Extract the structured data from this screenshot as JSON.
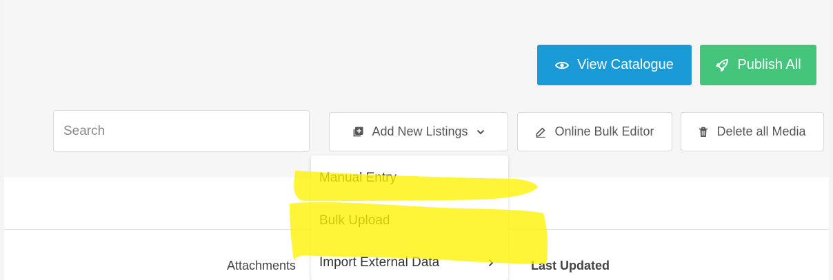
{
  "header": {
    "view_catalogue_label": "View Catalogue",
    "publish_all_label": "Publish All"
  },
  "toolbar": {
    "search_placeholder": "Search",
    "add_new_listings_label": "Add New Listings",
    "online_bulk_editor_label": "Online Bulk Editor",
    "delete_all_media_label": "Delete all Media"
  },
  "dropdown": {
    "items": [
      {
        "label": "Manual Entry"
      },
      {
        "label": "Bulk Upload"
      },
      {
        "label": "Import External Data"
      }
    ]
  },
  "table": {
    "columns": [
      "Attachments",
      "Last Updated"
    ]
  },
  "colors": {
    "view_catalogue": "#1a9ad6",
    "publish_all": "#45c47b",
    "highlighter": "#fff200"
  },
  "icons": {
    "view_catalogue": "eye-icon",
    "publish_all": "rocket-icon",
    "add_new_listings": "add-copy-icon",
    "dropdown": "chevron-down-icon",
    "online_bulk_editor": "pencil-icon",
    "delete_all_media": "trash-icon",
    "submenu": "chevron-right-icon"
  }
}
